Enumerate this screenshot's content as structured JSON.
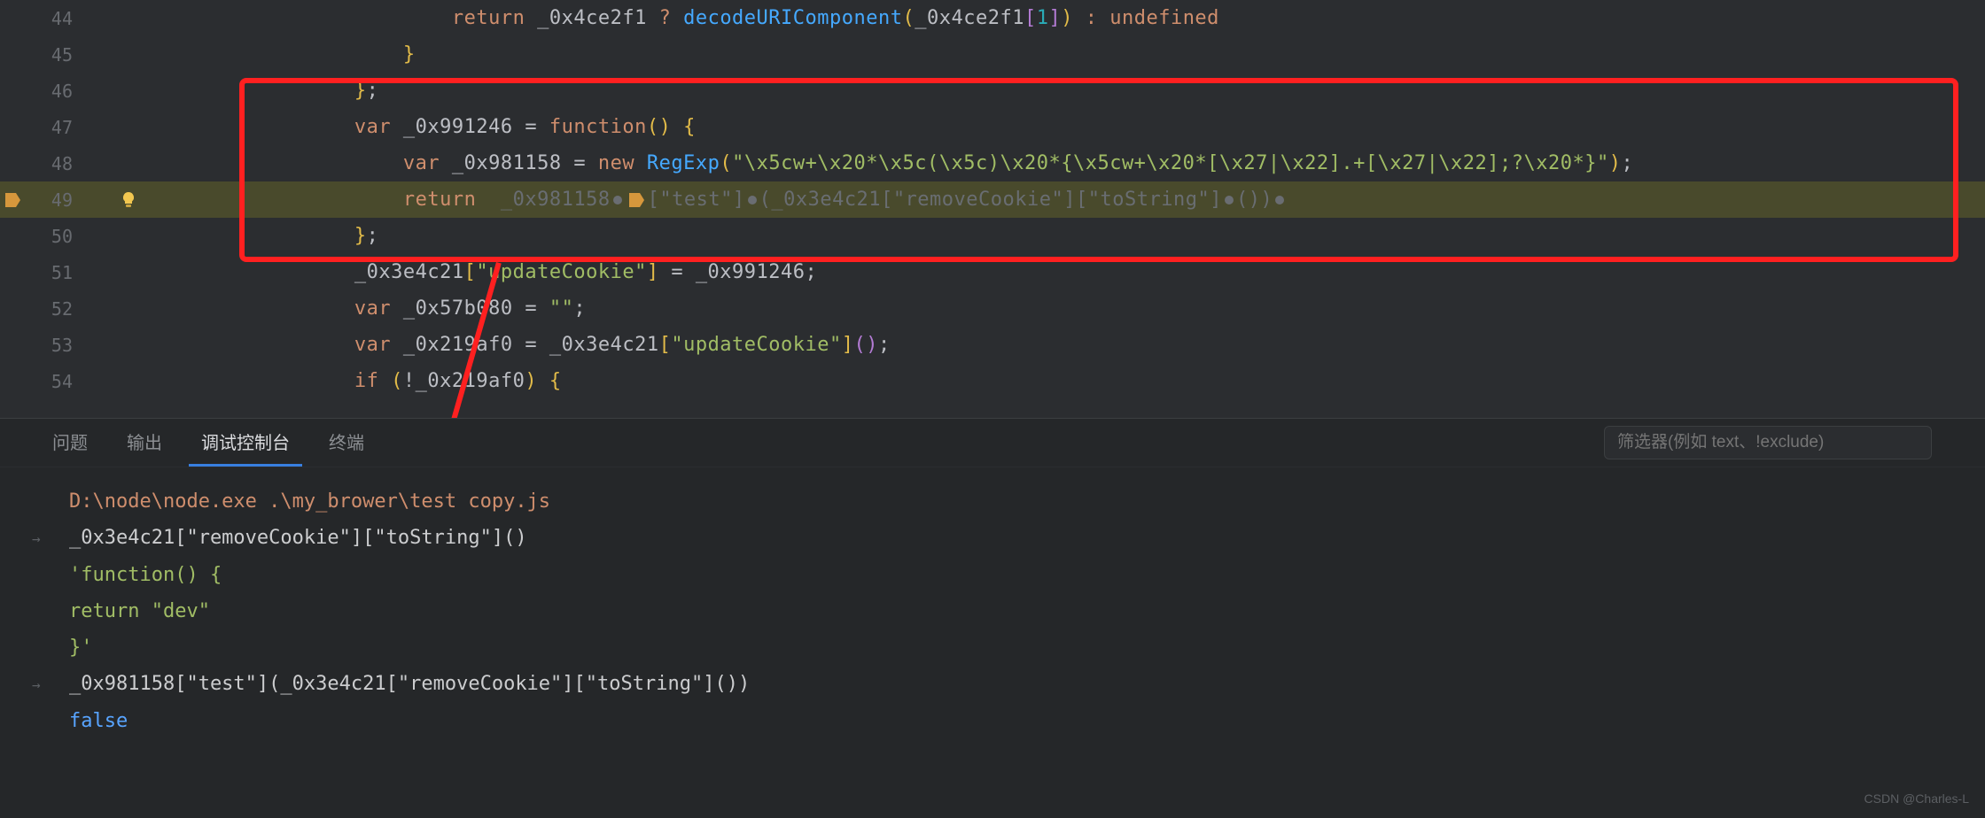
{
  "editor": {
    "lines": [
      {
        "n": "44",
        "hl": false,
        "bp": false,
        "bulb": false,
        "indent": 24,
        "tokens": [
          {
            "c": "ret",
            "t": "return"
          },
          {
            "c": "",
            "t": " _0x4ce2f1 "
          },
          {
            "c": "ret",
            "t": "?"
          },
          {
            "c": "",
            "t": " "
          },
          {
            "c": "fn",
            "t": "decodeURIComponent"
          },
          {
            "c": "par",
            "t": "("
          },
          {
            "c": "",
            "t": "_0x4ce2f1"
          },
          {
            "c": "par2",
            "t": "["
          },
          {
            "c": "num",
            "t": "1"
          },
          {
            "c": "par2",
            "t": "]"
          },
          {
            "c": "par",
            "t": ")"
          },
          {
            "c": "",
            "t": " "
          },
          {
            "c": "ret",
            "t": ":"
          },
          {
            "c": "",
            "t": " "
          },
          {
            "c": "kw",
            "t": "undefined"
          }
        ]
      },
      {
        "n": "45",
        "hl": false,
        "bp": false,
        "bulb": false,
        "indent": 20,
        "tokens": [
          {
            "c": "par",
            "t": "}"
          }
        ]
      },
      {
        "n": "46",
        "hl": false,
        "bp": false,
        "bulb": false,
        "indent": 16,
        "tokens": [
          {
            "c": "par",
            "t": "}"
          },
          {
            "c": "",
            "t": ";"
          }
        ]
      },
      {
        "n": "47",
        "hl": false,
        "bp": false,
        "bulb": false,
        "indent": 16,
        "tokens": [
          {
            "c": "kw",
            "t": "var"
          },
          {
            "c": "",
            "t": " _0x991246 "
          },
          {
            "c": "",
            "t": "= "
          },
          {
            "c": "kw",
            "t": "function"
          },
          {
            "c": "par",
            "t": "()"
          },
          {
            "c": "",
            "t": " "
          },
          {
            "c": "par",
            "t": "{"
          }
        ]
      },
      {
        "n": "48",
        "hl": false,
        "bp": false,
        "bulb": false,
        "indent": 20,
        "tokens": [
          {
            "c": "kw",
            "t": "var"
          },
          {
            "c": "",
            "t": " _0x981158 "
          },
          {
            "c": "",
            "t": "= "
          },
          {
            "c": "kw",
            "t": "new"
          },
          {
            "c": "",
            "t": " "
          },
          {
            "c": "fn",
            "t": "RegExp"
          },
          {
            "c": "par",
            "t": "("
          },
          {
            "c": "str",
            "t": "\"\\x5cw+\\x20*\\x5c(\\x5c)\\x20*{\\x5cw+\\x20*[\\x27|\\x22].+[\\x27|\\x22];?\\x20*}\""
          },
          {
            "c": "par",
            "t": ")"
          },
          {
            "c": "",
            "t": ";"
          }
        ]
      },
      {
        "n": "49",
        "hl": true,
        "bp": true,
        "bulb": true,
        "indent": 20,
        "tokens": [
          {
            "c": "ret",
            "t": "return"
          },
          {
            "c": "",
            "t": "  "
          },
          {
            "c": "mutg",
            "t": "_0x981158"
          },
          {
            "c": "dot",
            "t": ""
          },
          {
            "c": "inlinebp",
            "t": ""
          },
          {
            "c": "mutg",
            "t": "["
          },
          {
            "c": "mutg",
            "t": "\"test\""
          },
          {
            "c": "mutg",
            "t": "]"
          },
          {
            "c": "dot",
            "t": ""
          },
          {
            "c": "mutg",
            "t": "("
          },
          {
            "c": "mutg",
            "t": "_0x3e4c21"
          },
          {
            "c": "mutg",
            "t": "["
          },
          {
            "c": "mutg",
            "t": "\"removeCookie\""
          },
          {
            "c": "mutg",
            "t": "]"
          },
          {
            "c": "mutg",
            "t": "["
          },
          {
            "c": "mutg",
            "t": "\"toString\""
          },
          {
            "c": "mutg",
            "t": "]"
          },
          {
            "c": "dot",
            "t": ""
          },
          {
            "c": "mutg",
            "t": "()"
          },
          {
            "c": "mutg",
            "t": ")"
          },
          {
            "c": "dot",
            "t": ""
          }
        ]
      },
      {
        "n": "50",
        "hl": false,
        "bp": false,
        "bulb": false,
        "indent": 16,
        "tokens": [
          {
            "c": "par",
            "t": "}"
          },
          {
            "c": "",
            "t": ";"
          }
        ]
      },
      {
        "n": "51",
        "hl": false,
        "bp": false,
        "bulb": false,
        "indent": 16,
        "tokens": [
          {
            "c": "",
            "t": "_0x3e4c21"
          },
          {
            "c": "par",
            "t": "["
          },
          {
            "c": "str",
            "t": "\"updateCookie\""
          },
          {
            "c": "par",
            "t": "]"
          },
          {
            "c": "",
            "t": " = _0x991246;"
          }
        ]
      },
      {
        "n": "52",
        "hl": false,
        "bp": false,
        "bulb": false,
        "indent": 16,
        "tokens": [
          {
            "c": "kw",
            "t": "var"
          },
          {
            "c": "",
            "t": " _0x57b080 "
          },
          {
            "c": "",
            "t": "= "
          },
          {
            "c": "str",
            "t": "\"\""
          },
          {
            "c": "",
            "t": ";"
          }
        ]
      },
      {
        "n": "53",
        "hl": false,
        "bp": false,
        "bulb": false,
        "indent": 16,
        "tokens": [
          {
            "c": "kw",
            "t": "var"
          },
          {
            "c": "",
            "t": " _0x219af0 "
          },
          {
            "c": "",
            "t": "= _0x3e4c21"
          },
          {
            "c": "par",
            "t": "["
          },
          {
            "c": "str",
            "t": "\"updateCookie\""
          },
          {
            "c": "par",
            "t": "]"
          },
          {
            "c": "par2",
            "t": "()"
          },
          {
            "c": "",
            "t": ";"
          }
        ]
      },
      {
        "n": "54",
        "hl": false,
        "bp": false,
        "bulb": false,
        "indent": 16,
        "tokens": [
          {
            "c": "kw",
            "t": "if"
          },
          {
            "c": "",
            "t": " "
          },
          {
            "c": "par",
            "t": "("
          },
          {
            "c": "",
            "t": "!_0x219af0"
          },
          {
            "c": "par",
            "t": ")"
          },
          {
            "c": "",
            "t": " "
          },
          {
            "c": "par",
            "t": "{"
          }
        ]
      }
    ]
  },
  "tabs": {
    "items": [
      "问题",
      "输出",
      "调试控制台",
      "终端"
    ],
    "active": 2
  },
  "filter_placeholder": "筛选器(例如 text、!exclude)",
  "console": {
    "lines": [
      {
        "arrow": false,
        "indent": 1,
        "cls": "cpath",
        "text": "D:\\node\\node.exe .\\my_brower\\test copy.js"
      },
      {
        "arrow": true,
        "indent": 1,
        "cls": "ctext",
        "text": "_0x3e4c21[\"removeCookie\"][\"toString\"]()"
      },
      {
        "arrow": false,
        "indent": 1,
        "cls": "cquote",
        "text": "'function() {"
      },
      {
        "arrow": false,
        "indent": 10,
        "cls": "cquote",
        "text": "return \"dev\""
      },
      {
        "arrow": false,
        "indent": 8,
        "cls": "cquote",
        "text": "}'"
      },
      {
        "arrow": true,
        "indent": 1,
        "cls": "ctext",
        "text": "_0x981158[\"test\"](_0x3e4c21[\"removeCookie\"][\"toString\"]())"
      },
      {
        "arrow": false,
        "indent": 1,
        "cls": "cfalse",
        "text": "false"
      }
    ]
  },
  "watermark": "CSDN @Charles-L"
}
